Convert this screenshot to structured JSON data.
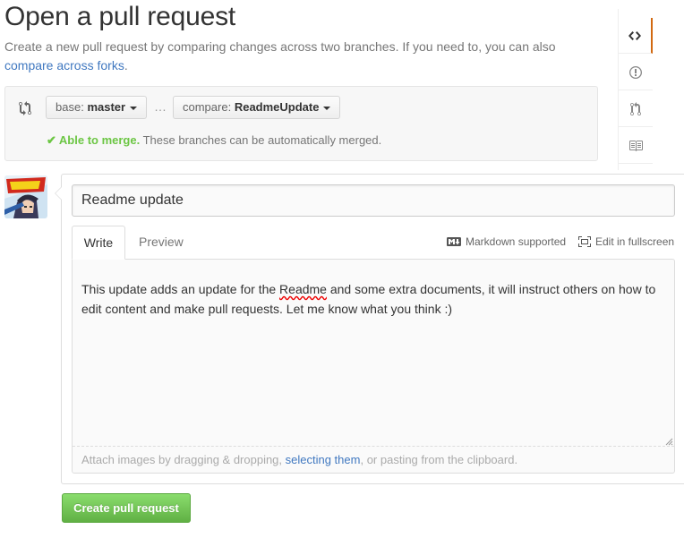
{
  "page": {
    "title": "Open a pull request",
    "subtitle_text": "Create a new pull request by comparing changes across two branches. If you need to, you can also",
    "subtitle_link": "compare across forks",
    "subtitle_end": "."
  },
  "range": {
    "base_label": "base:",
    "base_value": "master",
    "ellipsis": "…",
    "compare_label": "compare:",
    "compare_value": "ReadmeUpdate",
    "merge_status": "Able to merge.",
    "merge_detail": "These branches can be automatically merged."
  },
  "composer": {
    "title_value": "Readme update",
    "tabs": [
      {
        "label": "Write",
        "active": true
      },
      {
        "label": "Preview",
        "active": false
      }
    ],
    "markdown_label": "Markdown supported",
    "fullscreen_label": "Edit in fullscreen",
    "body_before": "This update adds an update for the ",
    "body_misspelled": "Readme",
    "body_after": " and some extra documents, it will instruct others on how to edit content and make pull requests. Let me know what you think :)",
    "attach_before": "Attach images by dragging & dropping, ",
    "attach_link": "selecting them",
    "attach_after": ", or pasting from the clipboard."
  },
  "actions": {
    "submit_label": "Create pull request"
  },
  "sidenav": {
    "items": [
      "code-icon",
      "issues-icon",
      "pull-request-icon",
      "wiki-icon"
    ]
  },
  "colors": {
    "accent_green": "#6cc644",
    "link_blue": "#4078c0",
    "active_nav_orange": "#d26911"
  }
}
